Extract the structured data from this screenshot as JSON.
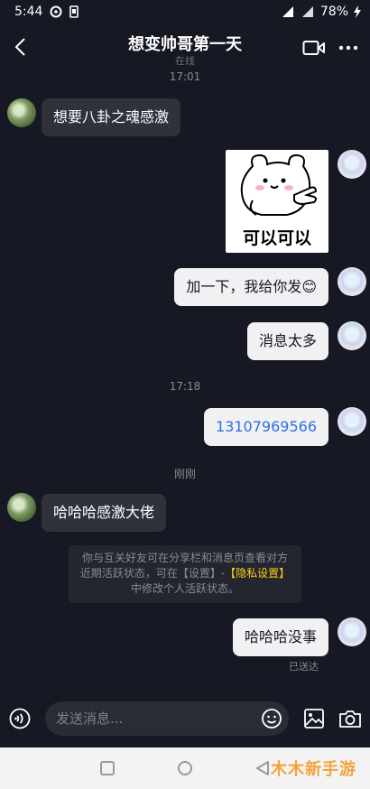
{
  "status_bar": {
    "time": "5:44",
    "battery": "78%"
  },
  "header": {
    "title": "想变帅哥第一天",
    "subtitle": "在线"
  },
  "messages": [
    {
      "type": "timestamp",
      "text": "17:01"
    },
    {
      "type": "text",
      "side": "in",
      "text": "想要八卦之魂感激"
    },
    {
      "type": "sticker",
      "side": "out",
      "caption": "可以可以"
    },
    {
      "type": "text",
      "side": "out",
      "text": "加一下，我给你发😊"
    },
    {
      "type": "text",
      "side": "out",
      "text": "消息太多"
    },
    {
      "type": "timestamp",
      "text": "17:18"
    },
    {
      "type": "text",
      "side": "out",
      "text": "13107969566"
    },
    {
      "type": "timestamp",
      "text": "刚刚"
    },
    {
      "type": "text",
      "side": "in",
      "text": "哈哈哈感激大佬"
    },
    {
      "type": "text",
      "side": "out",
      "text": "哈哈哈没事"
    }
  ],
  "notice": {
    "part1": "你与互关好友可在分享栏和消息页查看对方近期活跃状态，可在【设置】-",
    "highlight": "【隐私设置】",
    "part2": "中修改个人活跃状态。"
  },
  "sent_status": "已送达",
  "input": {
    "placeholder": "发送消息..."
  },
  "watermark": "木木新手游",
  "colors": {
    "background": "#161823",
    "incoming_bubble": "#2f313b",
    "outgoing_bubble": "#f1f1f3",
    "phone_link": "#2f6fe4",
    "highlight": "#face15"
  },
  "icons": [
    "back-arrow-icon",
    "video-call-icon",
    "more-icon",
    "voice-icon",
    "emoji-icon",
    "image-icon",
    "camera-icon"
  ]
}
